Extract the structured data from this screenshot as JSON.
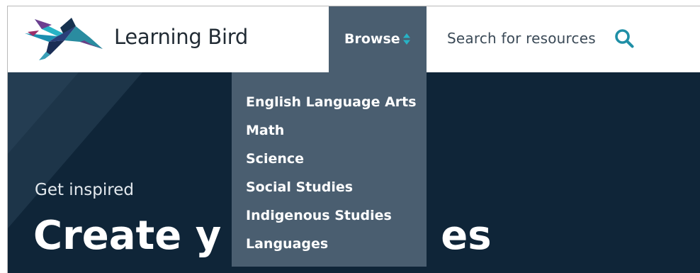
{
  "brand": {
    "name": "Learning Bird",
    "logo_icon": "flying-bird-logo"
  },
  "nav": {
    "browse_label": "Browse",
    "browse_icon": "sort-arrows-icon",
    "search_label": "Search for resources",
    "search_icon": "magnifier-icon"
  },
  "browse_menu": {
    "items": [
      "English Language Arts",
      "Math",
      "Science",
      "Social Studies",
      "Indigenous Studies",
      "Languages"
    ]
  },
  "hero": {
    "eyebrow": "Get inspired",
    "heading_left": "Create y",
    "heading_right": "es"
  },
  "colors": {
    "header_bg": "#ffffff",
    "browse_bg": "#4a5e70",
    "hero_bg": "#0f2538",
    "accent_teal": "#1f8fa6",
    "text_dark": "#222c35"
  }
}
